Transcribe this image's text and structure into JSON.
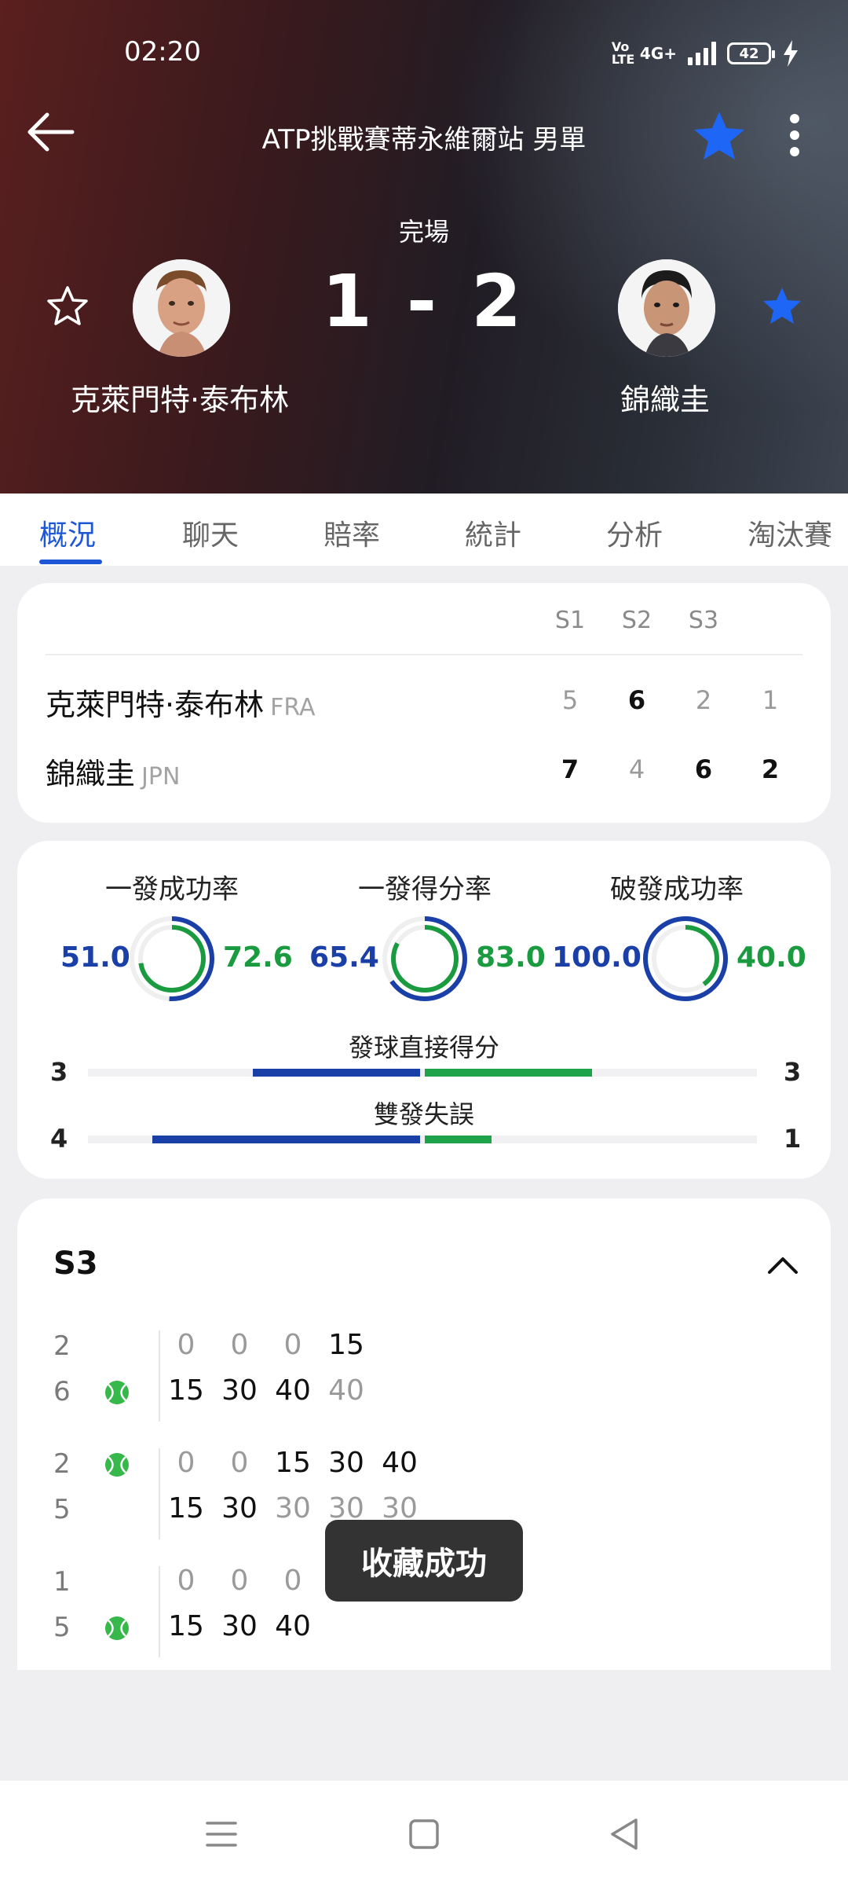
{
  "status_bar": {
    "time": "02:20",
    "volte": "Vo LTE",
    "network": "4G+",
    "battery": "42"
  },
  "header": {
    "title": "ATP挑戰賽蒂永維爾站 男單",
    "match_status": "完場",
    "score": "1 - 2",
    "player1": {
      "name": "克萊門特·泰布林",
      "favorited": false
    },
    "player2": {
      "name": "錦織圭",
      "favorited": true
    }
  },
  "tabs": [
    "概況",
    "聊天",
    "賠率",
    "統計",
    "分析",
    "淘汰賽"
  ],
  "scoreboard": {
    "set_headers": [
      "S1",
      "S2",
      "S3"
    ],
    "rows": [
      {
        "name": "克萊門特·泰布林",
        "country": "FRA",
        "sets": [
          "5",
          "6",
          "2"
        ],
        "current": "1"
      },
      {
        "name": "錦織圭",
        "country": "JPN",
        "sets": [
          "7",
          "4",
          "6"
        ],
        "current": "2"
      }
    ]
  },
  "stats": {
    "rings": [
      {
        "label": "一發成功率",
        "left": "51.0",
        "right": "72.6",
        "left_frac": 0.51,
        "right_frac": 0.726
      },
      {
        "label": "一發得分率",
        "left": "65.4",
        "right": "83.0",
        "left_frac": 0.654,
        "right_frac": 0.83
      },
      {
        "label": "破發成功率",
        "left": "100.0",
        "right": "40.0",
        "left_frac": 1.0,
        "right_frac": 0.4
      }
    ],
    "bars": [
      {
        "label": "發球直接得分",
        "left": "3",
        "right": "3",
        "left_frac": 0.5,
        "right_frac": 0.5
      },
      {
        "label": "雙發失誤",
        "left": "4",
        "right": "1",
        "left_frac": 0.8,
        "right_frac": 0.2
      }
    ]
  },
  "point_by_point": {
    "set": "S3",
    "games": [
      {
        "top_score": "2",
        "bottom_score": "6",
        "server": "bottom",
        "top_points": [
          "0",
          "0",
          "0",
          "15"
        ],
        "bottom_points": [
          "15",
          "30",
          "40",
          "40"
        ]
      },
      {
        "top_score": "2",
        "bottom_score": "5",
        "server": "top",
        "top_points": [
          "0",
          "0",
          "15",
          "30",
          "40"
        ],
        "bottom_points": [
          "15",
          "30",
          "30",
          "30",
          "30"
        ]
      },
      {
        "top_score": "1",
        "bottom_score": "5",
        "server": "bottom",
        "top_points": [
          "0",
          "0",
          "0"
        ],
        "bottom_points": [
          "15",
          "30",
          "40"
        ]
      }
    ]
  },
  "toast": "收藏成功",
  "colors": {
    "accent": "#1d57d6",
    "player1": "#1a3fa6",
    "player2": "#1a9b40",
    "star": "#1e66f5"
  }
}
